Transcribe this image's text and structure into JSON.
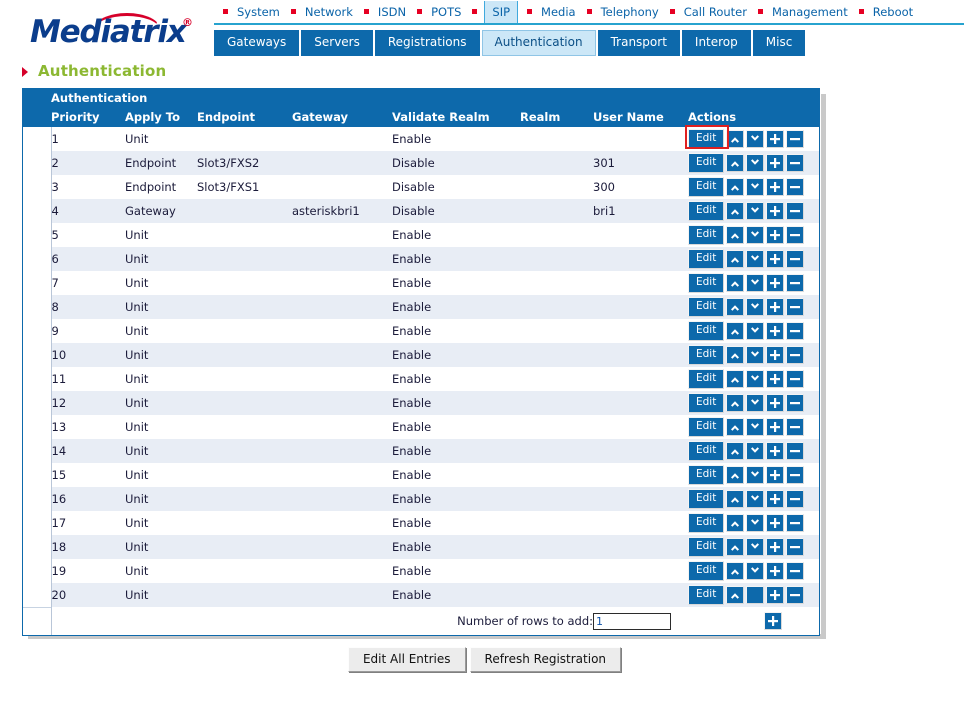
{
  "brand": {
    "name": "Mediatrix",
    "registered_mark": "®"
  },
  "topnav": {
    "items": [
      {
        "label": "System",
        "active": false
      },
      {
        "label": "Network",
        "active": false
      },
      {
        "label": "ISDN",
        "active": false
      },
      {
        "label": "POTS",
        "active": false
      },
      {
        "label": "SIP",
        "active": true
      },
      {
        "label": "Media",
        "active": false
      },
      {
        "label": "Telephony",
        "active": false
      },
      {
        "label": "Call Router",
        "active": false
      },
      {
        "label": "Management",
        "active": false
      },
      {
        "label": "Reboot",
        "active": false
      }
    ]
  },
  "subtabs": {
    "items": [
      {
        "label": "Gateways",
        "active": false
      },
      {
        "label": "Servers",
        "active": false
      },
      {
        "label": "Registrations",
        "active": false
      },
      {
        "label": "Authentication",
        "active": true
      },
      {
        "label": "Transport",
        "active": false
      },
      {
        "label": "Interop",
        "active": false
      },
      {
        "label": "Misc",
        "active": false
      }
    ]
  },
  "page": {
    "title": "Authentication"
  },
  "table": {
    "caption": "Authentication",
    "columns": [
      "Priority",
      "Apply To",
      "Endpoint",
      "Gateway",
      "Validate Realm",
      "Realm",
      "User Name",
      "Actions"
    ],
    "action_labels": {
      "edit": "Edit",
      "move_up": "up-chevron",
      "move_down": "down-chevron",
      "add": "+",
      "remove": "−"
    },
    "rows": [
      {
        "priority": "1",
        "apply_to": "Unit",
        "endpoint": "",
        "gateway": "",
        "validate_realm": "Enable",
        "realm": "",
        "user_name": "",
        "highlighted": true
      },
      {
        "priority": "2",
        "apply_to": "Endpoint",
        "endpoint": "Slot3/FXS2",
        "gateway": "",
        "validate_realm": "Disable",
        "realm": "",
        "user_name": "301",
        "highlighted": false
      },
      {
        "priority": "3",
        "apply_to": "Endpoint",
        "endpoint": "Slot3/FXS1",
        "gateway": "",
        "validate_realm": "Disable",
        "realm": "",
        "user_name": "300",
        "highlighted": false
      },
      {
        "priority": "4",
        "apply_to": "Gateway",
        "endpoint": "",
        "gateway": "asteriskbri1",
        "validate_realm": "Disable",
        "realm": "",
        "user_name": "bri1",
        "highlighted": false
      },
      {
        "priority": "5",
        "apply_to": "Unit",
        "endpoint": "",
        "gateway": "",
        "validate_realm": "Enable",
        "realm": "",
        "user_name": "",
        "highlighted": false
      },
      {
        "priority": "6",
        "apply_to": "Unit",
        "endpoint": "",
        "gateway": "",
        "validate_realm": "Enable",
        "realm": "",
        "user_name": "",
        "highlighted": false
      },
      {
        "priority": "7",
        "apply_to": "Unit",
        "endpoint": "",
        "gateway": "",
        "validate_realm": "Enable",
        "realm": "",
        "user_name": "",
        "highlighted": false
      },
      {
        "priority": "8",
        "apply_to": "Unit",
        "endpoint": "",
        "gateway": "",
        "validate_realm": "Enable",
        "realm": "",
        "user_name": "",
        "highlighted": false
      },
      {
        "priority": "9",
        "apply_to": "Unit",
        "endpoint": "",
        "gateway": "",
        "validate_realm": "Enable",
        "realm": "",
        "user_name": "",
        "highlighted": false
      },
      {
        "priority": "10",
        "apply_to": "Unit",
        "endpoint": "",
        "gateway": "",
        "validate_realm": "Enable",
        "realm": "",
        "user_name": "",
        "highlighted": false
      },
      {
        "priority": "11",
        "apply_to": "Unit",
        "endpoint": "",
        "gateway": "",
        "validate_realm": "Enable",
        "realm": "",
        "user_name": "",
        "highlighted": false
      },
      {
        "priority": "12",
        "apply_to": "Unit",
        "endpoint": "",
        "gateway": "",
        "validate_realm": "Enable",
        "realm": "",
        "user_name": "",
        "highlighted": false
      },
      {
        "priority": "13",
        "apply_to": "Unit",
        "endpoint": "",
        "gateway": "",
        "validate_realm": "Enable",
        "realm": "",
        "user_name": "",
        "highlighted": false
      },
      {
        "priority": "14",
        "apply_to": "Unit",
        "endpoint": "",
        "gateway": "",
        "validate_realm": "Enable",
        "realm": "",
        "user_name": "",
        "highlighted": false
      },
      {
        "priority": "15",
        "apply_to": "Unit",
        "endpoint": "",
        "gateway": "",
        "validate_realm": "Enable",
        "realm": "",
        "user_name": "",
        "highlighted": false
      },
      {
        "priority": "16",
        "apply_to": "Unit",
        "endpoint": "",
        "gateway": "",
        "validate_realm": "Enable",
        "realm": "",
        "user_name": "",
        "highlighted": false
      },
      {
        "priority": "17",
        "apply_to": "Unit",
        "endpoint": "",
        "gateway": "",
        "validate_realm": "Enable",
        "realm": "",
        "user_name": "",
        "highlighted": false
      },
      {
        "priority": "18",
        "apply_to": "Unit",
        "endpoint": "",
        "gateway": "",
        "validate_realm": "Enable",
        "realm": "",
        "user_name": "",
        "highlighted": false
      },
      {
        "priority": "19",
        "apply_to": "Unit",
        "endpoint": "",
        "gateway": "",
        "validate_realm": "Enable",
        "realm": "",
        "user_name": "",
        "highlighted": false
      },
      {
        "priority": "20",
        "apply_to": "Unit",
        "endpoint": "",
        "gateway": "",
        "validate_realm": "Enable",
        "realm": "",
        "user_name": "",
        "highlighted": false,
        "last": true
      }
    ],
    "add_row": {
      "label": "Number of rows to add:",
      "value": "1",
      "button": "+"
    }
  },
  "footer_buttons": {
    "edit_all": "Edit All Entries",
    "refresh": "Refresh Registration"
  },
  "colors": {
    "brand_blue": "#0b3d8c",
    "brand_red": "#d6002a",
    "header_blue": "#0d69ab",
    "active_tab": "#cce7f7",
    "title_green": "#8cb832",
    "row_alt": "#e8edf5",
    "highlight_red": "#e02020"
  }
}
